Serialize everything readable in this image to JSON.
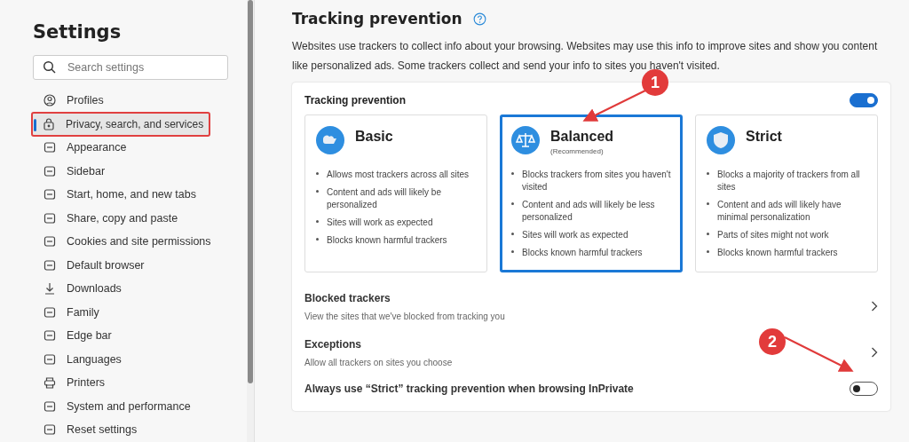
{
  "sidebar": {
    "title": "Settings",
    "search": {
      "placeholder": "Search settings"
    },
    "items": [
      {
        "label": "Profiles",
        "selected": false,
        "outlined": false
      },
      {
        "label": "Privacy, search, and services",
        "selected": true,
        "outlined": true
      },
      {
        "label": "Appearance",
        "selected": false,
        "outlined": false
      },
      {
        "label": "Sidebar",
        "selected": false,
        "outlined": false
      },
      {
        "label": "Start, home, and new tabs",
        "selected": false,
        "outlined": false
      },
      {
        "label": "Share, copy and paste",
        "selected": false,
        "outlined": false
      },
      {
        "label": "Cookies and site permissions",
        "selected": false,
        "outlined": false
      },
      {
        "label": "Default browser",
        "selected": false,
        "outlined": false
      },
      {
        "label": "Downloads",
        "selected": false,
        "outlined": false
      },
      {
        "label": "Family",
        "selected": false,
        "outlined": false
      },
      {
        "label": "Edge bar",
        "selected": false,
        "outlined": false
      },
      {
        "label": "Languages",
        "selected": false,
        "outlined": false
      },
      {
        "label": "Printers",
        "selected": false,
        "outlined": false
      },
      {
        "label": "System and performance",
        "selected": false,
        "outlined": false
      },
      {
        "label": "Reset settings",
        "selected": false,
        "outlined": false
      }
    ]
  },
  "main": {
    "title": "Tracking prevention",
    "description": "Websites use trackers to collect info about your browsing. Websites may use this info to improve sites and show you content like personalized ads. Some trackers collect and send your info to sites you haven't visited.",
    "card": {
      "label": "Tracking prevention",
      "on": true,
      "options": [
        {
          "title": "Basic",
          "selected": false,
          "bullets": [
            "Allows most trackers across all sites",
            "Content and ads will likely be personalized",
            "Sites will work as expected",
            "Blocks known harmful trackers"
          ]
        },
        {
          "title": "Balanced",
          "subtitle": "(Recommended)",
          "selected": true,
          "bullets": [
            "Blocks trackers from sites you haven't visited",
            "Content and ads will likely be less personalized",
            "Sites will work as expected",
            "Blocks known harmful trackers"
          ]
        },
        {
          "title": "Strict",
          "selected": false,
          "bullets": [
            "Blocks a majority of trackers from all sites",
            "Content and ads will likely have minimal personalization",
            "Parts of sites might not work",
            "Blocks known harmful trackers"
          ]
        }
      ],
      "rows": [
        {
          "kind": "link",
          "title": "Blocked trackers",
          "subtitle": "View the sites that we've blocked from tracking you"
        },
        {
          "kind": "link",
          "title": "Exceptions",
          "subtitle": "Allow all trackers on sites you choose"
        },
        {
          "kind": "toggle",
          "title": "Always use “Strict” tracking prevention when browsing InPrivate",
          "on": false
        }
      ]
    }
  },
  "annotations": [
    {
      "label": "1"
    },
    {
      "label": "2"
    }
  ]
}
